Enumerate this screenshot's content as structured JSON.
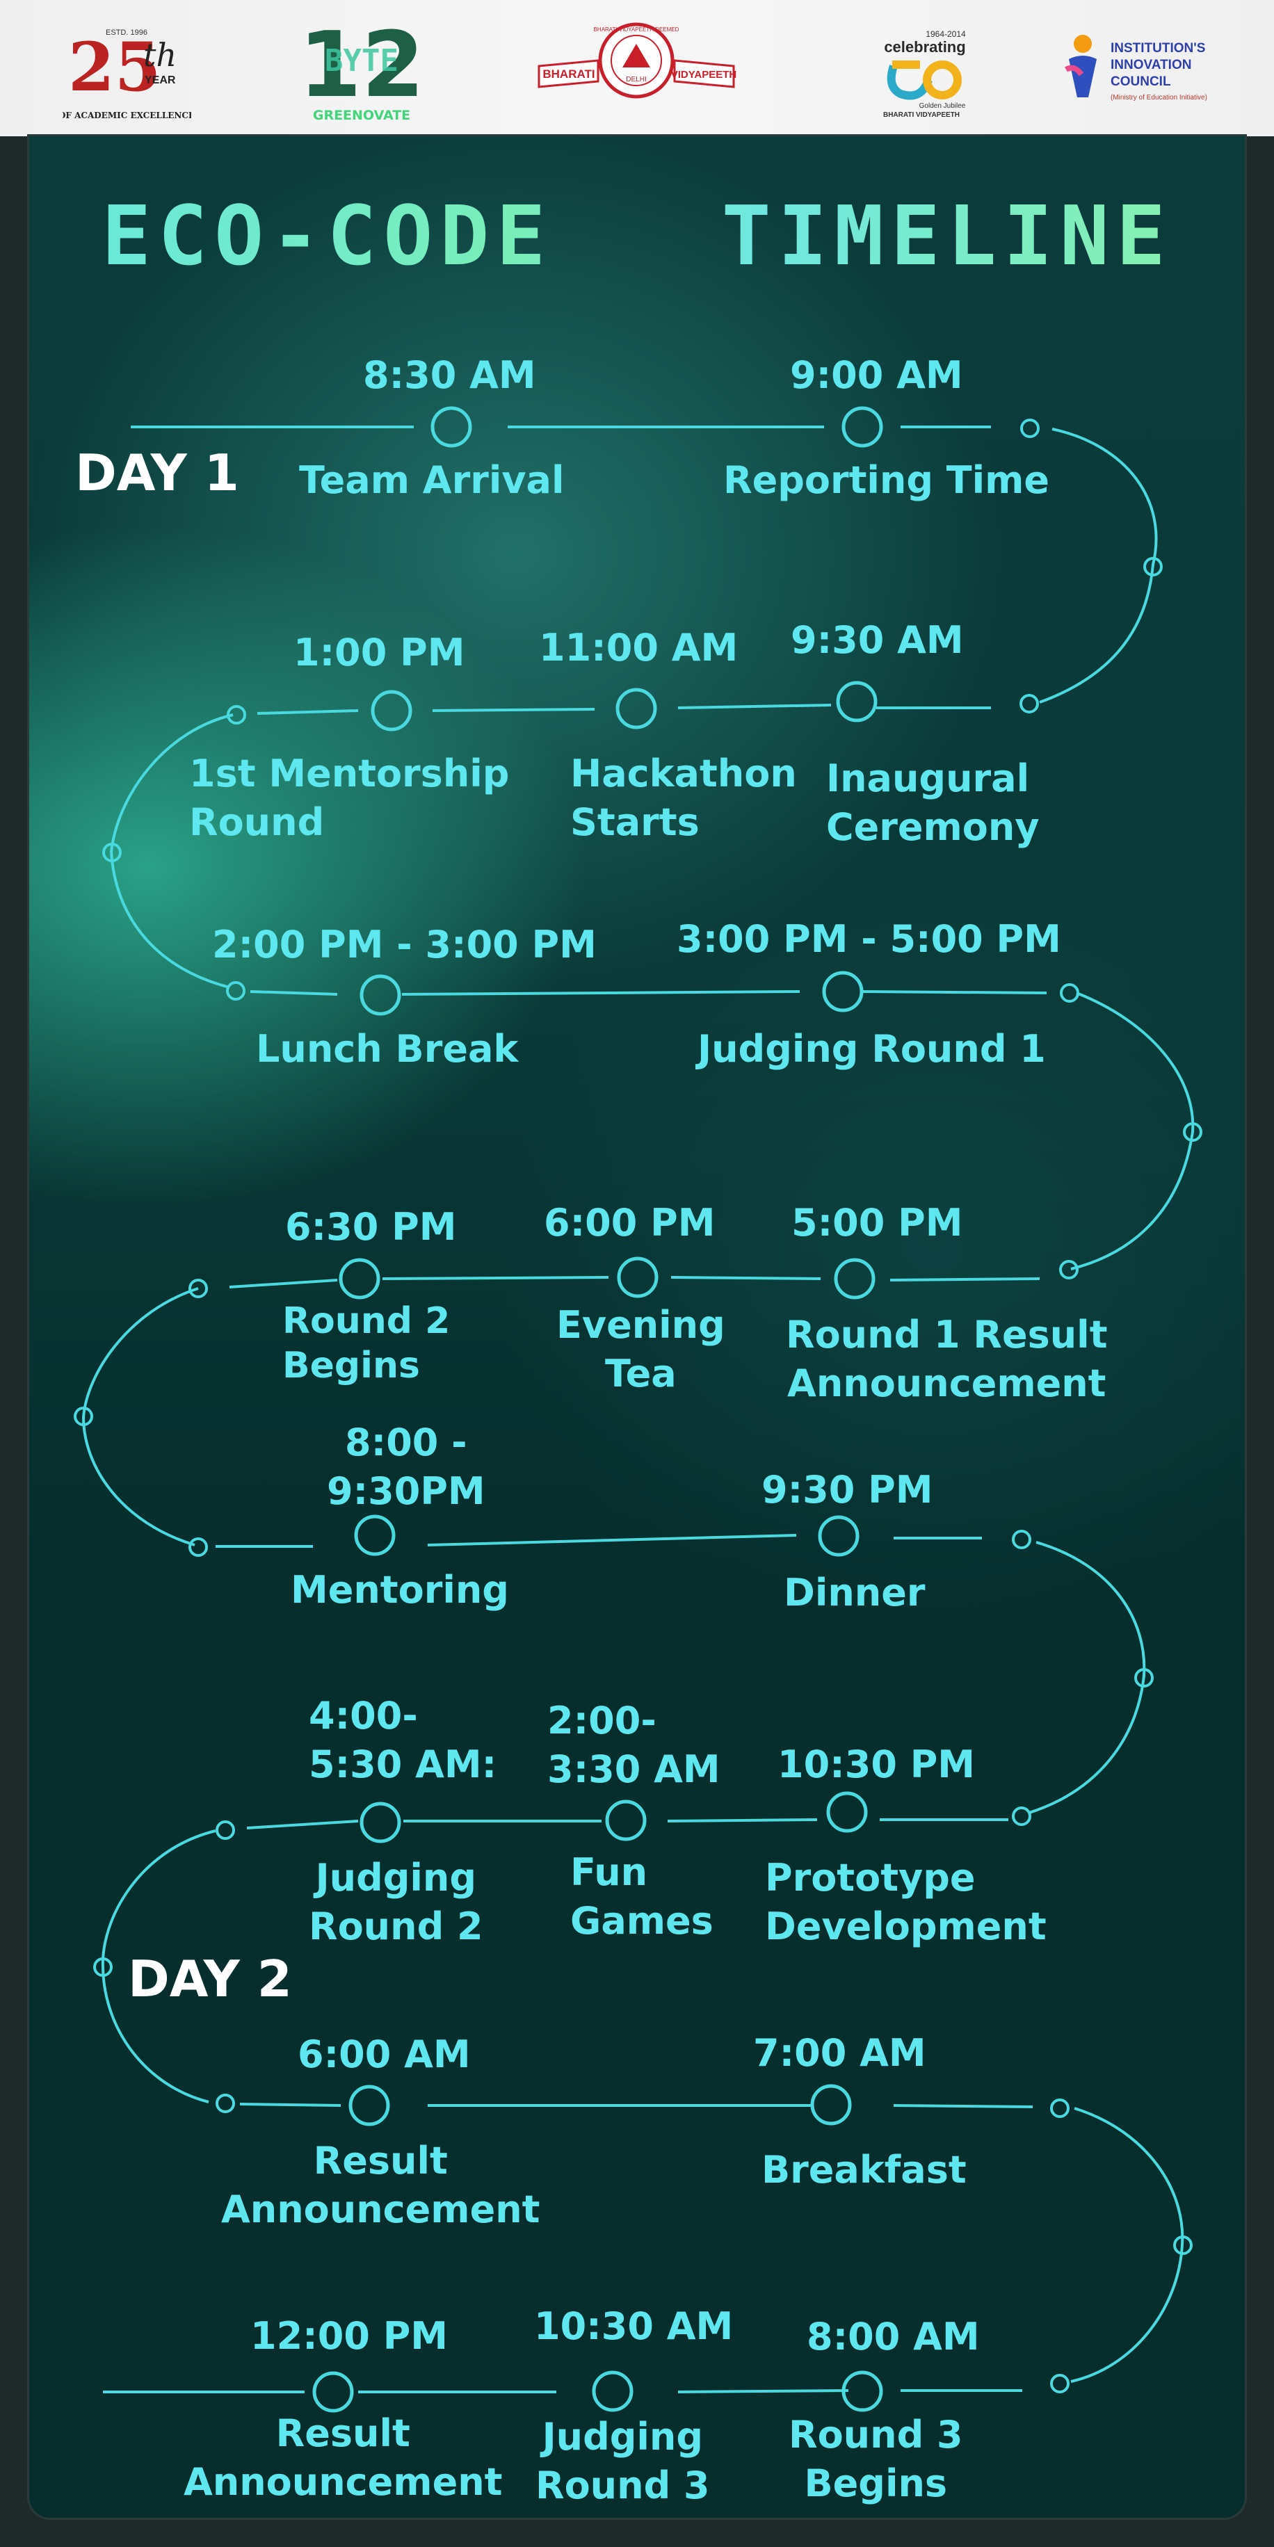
{
  "header": {
    "logo_25th": {
      "top_text": "ESTD. 1996",
      "number": "25",
      "suffix": "th",
      "year": "YEAR",
      "bottom_text": "OF ACADEMIC EXCELLENCE"
    },
    "logo_byte": {
      "number": "12",
      "word": "BYTE",
      "caption": "GREENOVATE"
    },
    "logo_bharati": {
      "left": "BHARATI",
      "right": "VIDYAPEETH",
      "arc": "BHARATI VIDYAPEETH DEEMED",
      "center": "DELHI"
    },
    "logo_jubilee": {
      "years": "1964-2014",
      "headline": "celebrating",
      "sub1": "Golden Jubilee",
      "sub2": "BHARATI VIDYAPEETH"
    },
    "logo_iic": {
      "line1": "INSTITUTION'S",
      "line2": "INNOVATION",
      "line3": "COUNCIL",
      "line4": "(Ministry of Education Initiative)"
    }
  },
  "poster": {
    "title_left": "ECO-CODE",
    "title_right": "TIMELINE",
    "day1": "DAY 1",
    "day2": "DAY 2",
    "events": [
      {
        "time": "8:30 AM",
        "label": "Team Arrival"
      },
      {
        "time": "9:00 AM",
        "label": "Reporting Time"
      },
      {
        "time": "9:30 AM",
        "label": "Inaugural\nCeremony"
      },
      {
        "time": "11:00 AM",
        "label": "Hackathon\nStarts"
      },
      {
        "time": "1:00 PM",
        "label": "1st Mentorship\nRound"
      },
      {
        "time": "2:00 PM - 3:00 PM",
        "label": "Lunch Break"
      },
      {
        "time": "3:00 PM - 5:00 PM",
        "label": "Judging Round 1"
      },
      {
        "time": "5:00 PM",
        "label": "Round 1 Result\nAnnouncement"
      },
      {
        "time": "6:00 PM",
        "label": "Evening\nTea"
      },
      {
        "time": "6:30 PM",
        "label": "Round 2\nBegins"
      },
      {
        "time": "8:00 -\n9:30PM",
        "label": "Mentoring"
      },
      {
        "time": "9:30 PM",
        "label": "Dinner"
      },
      {
        "time": "10:30 PM",
        "label": "Prototype\nDevelopment"
      },
      {
        "time": "2:00-\n3:30 AM",
        "label": "Fun\nGames"
      },
      {
        "time": "4:00-\n5:30 AM:",
        "label": "Judging\nRound 2"
      },
      {
        "time": "6:00 AM",
        "label": "Result\nAnnouncement"
      },
      {
        "time": "7:00 AM",
        "label": "Breakfast"
      },
      {
        "time": "8:00 AM",
        "label": "Round 3\nBegins"
      },
      {
        "time": "10:30 AM",
        "label": "Judging\nRound 3"
      },
      {
        "time": "12:00 PM",
        "label": "Result\nAnnouncement"
      }
    ]
  },
  "colors": {
    "accent": "#5fe7ef",
    "line": "#49d9de",
    "day_text": "#ffffff",
    "title_start": "#67e6e0",
    "title_end": "#8cf3a6"
  }
}
